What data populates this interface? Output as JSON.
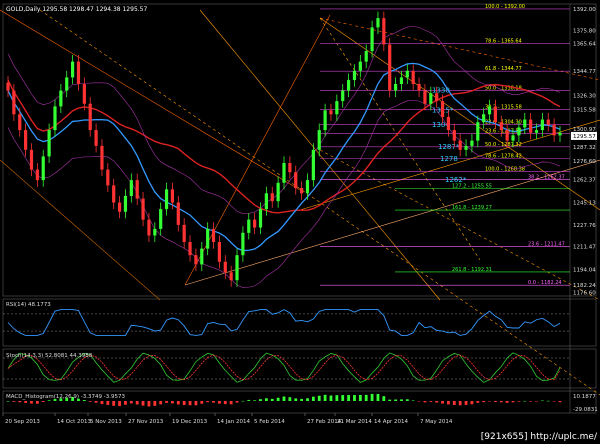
{
  "chart_data": {
    "type": "candlestick",
    "symbol_header": "GOLD,Daily  1295.58 1298.47 1294.38 1295.57",
    "price_axis": [
      "1392.00",
      "1375.80",
      "1365.64",
      "1344.77",
      "1326.30",
      "1315.58",
      "1300.97",
      "1287.32",
      "1276.60",
      "1262.37",
      "1245.13",
      "1227.76",
      "1211.47",
      "1194.04",
      "1182.24",
      "1176.60"
    ],
    "current_price": "1295.57",
    "x_labels": [
      "20 Sep 2013",
      "14 Oct 2013",
      "5 Nov 2013",
      "27 Nov 2013",
      "19 Dec 2013",
      "14 Jan 2014",
      "5 Feb 2014",
      "27 Feb 2014",
      "21 Mar 2014",
      "14 Apr 2014",
      "7 May 2014"
    ],
    "fib_levels": [
      {
        "label": "100.0 - 1392.00",
        "price": 1392.0,
        "color": "#ffff00"
      },
      {
        "label": "78.6 - 1365.64",
        "price": 1365.64,
        "color": "#ffff00"
      },
      {
        "label": "61.8 - 1344.77",
        "price": 1344.77,
        "color": "#ffff00"
      },
      {
        "label": "50.0 - 1330.18",
        "price": 1330.18,
        "color": "#ffff00"
      },
      {
        "label": "38.2 - 1315.58",
        "price": 1315.58,
        "color": "#ffff00"
      },
      {
        "label": "23.6 - 1304.30",
        "price": 1304.3,
        "color": "#ffff00"
      },
      {
        "label": "23.6 - 1297.53",
        "price": 1297.53,
        "color": "#ffff00"
      },
      {
        "label": "50.0 - 1287.32",
        "price": 1287.32,
        "color": "#ffff00"
      },
      {
        "label": "78.6 - 1278.42",
        "price": 1278.42,
        "color": "#ffff00"
      },
      {
        "label": "100.0 - 1268.38",
        "price": 1268.38,
        "color": "#ffff00"
      },
      {
        "label": "38.2 - 1262.37",
        "price": 1262.37,
        "color": "#ff66ff"
      },
      {
        "label": "127.2 - 1255.55",
        "price": 1255.55,
        "color": "#33ff33"
      },
      {
        "label": "161.8 - 1239.27",
        "price": 1239.27,
        "color": "#33ff33"
      },
      {
        "label": "23.6 - 1211.47",
        "price": 1211.47,
        "color": "#ff66ff"
      },
      {
        "label": "261.8 - 1192.31",
        "price": 1192.31,
        "color": "#33ff33"
      },
      {
        "label": "0.0 - 1182.24",
        "price": 1182.24,
        "color": "#ff66ff"
      }
    ],
    "key_levels": [
      {
        "label": "1330",
        "price": 1330.0
      },
      {
        "label": "1315*",
        "price": 1315.0
      },
      {
        "label": "1304",
        "price": 1304.0
      },
      {
        "label": "1287*",
        "price": 1287.0
      },
      {
        "label": "1278",
        "price": 1278.0
      },
      {
        "label": "1262*",
        "price": 1262.0
      }
    ],
    "close_series": [
      1330,
      1312,
      1300,
      1285,
      1270,
      1262,
      1280,
      1300,
      1318,
      1330,
      1340,
      1352,
      1335,
      1320,
      1300,
      1288,
      1270,
      1258,
      1245,
      1238,
      1250,
      1262,
      1248,
      1232,
      1220,
      1225,
      1240,
      1255,
      1245,
      1228,
      1215,
      1205,
      1198,
      1210,
      1225,
      1215,
      1200,
      1192,
      1186,
      1205,
      1222,
      1232,
      1226,
      1240,
      1252,
      1246,
      1260,
      1275,
      1268,
      1256,
      1252,
      1262,
      1285,
      1300,
      1315,
      1312,
      1322,
      1330,
      1338,
      1345,
      1352,
      1360,
      1378,
      1385,
      1365,
      1330,
      1335,
      1340,
      1345,
      1335,
      1330,
      1320,
      1328,
      1322,
      1310,
      1300,
      1292,
      1285,
      1288,
      1292,
      1306,
      1312,
      1318,
      1306,
      1300,
      1292,
      1296,
      1302,
      1308,
      1298,
      1300,
      1308,
      1304,
      1296,
      1298
    ],
    "rsi": {
      "label": "RSI(14) 48.1773",
      "value": 48.1773,
      "levels": [
        70,
        30
      ]
    },
    "stoch": {
      "label": "Stoch(14,3,3) 52.8081 44.3988",
      "main": 52.8081,
      "signal": 44.3988
    },
    "macd": {
      "label": "MACD_Histogram(12,26,9) -3.3749 -3.9573",
      "hist": -3.3749,
      "signal": -3.9573,
      "axis_top": "10.1877",
      "axis_bottom": "-29.0831"
    }
  },
  "footer": {
    "size_text": "[921x655]",
    "site_text": "http://uplc.me/"
  }
}
